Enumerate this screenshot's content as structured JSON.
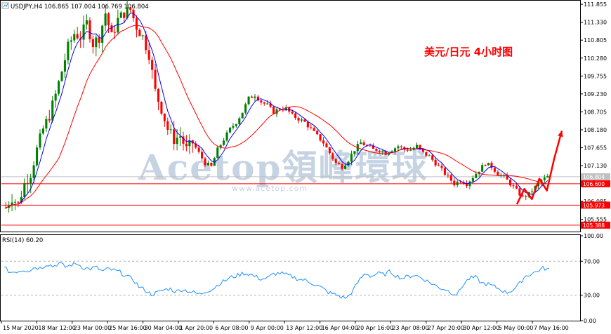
{
  "chart_data": [
    {
      "type": "candlestick",
      "title": "USDJPY,H4  106.865 107.004 106.769 106.804",
      "annotation": "美元/日元  4小时图",
      "watermark": "Acetop領峰環球",
      "watermark_url": "www.acetop.com",
      "x_ticks": [
        "15 Mar 2020",
        "18 Mar 12:00",
        "23 Mar 00:00",
        "25 Mar 16:00",
        "30 Mar 04:00",
        "1 Apr 20:00",
        "6 Apr 08:00",
        "9 Apr 00:00",
        "13 Apr 12:00",
        "16 Apr 04:00",
        "20 Apr 16:00",
        "23 Apr 08:00",
        "27 Apr 20:00",
        "30 Apr 12:00",
        "5 May 00:00",
        "7 May 16:00"
      ],
      "y_ticks": [
        111.855,
        111.33,
        110.805,
        110.28,
        109.755,
        109.23,
        108.705,
        108.18,
        107.655,
        107.13,
        106.6,
        106.085,
        105.555
      ],
      "ylim": [
        105.2,
        111.96
      ],
      "last_price": 106.804,
      "levels": [
        {
          "value": 106.6,
          "label": "106.600",
          "color": "#ff0000"
        },
        {
          "value": 105.973,
          "label": "105.973",
          "color": "#ff0000"
        },
        {
          "value": 105.388,
          "label": "105.388",
          "color": "#ff0000"
        }
      ],
      "series": [
        {
          "name": "MA-fast",
          "color": "#0000ff"
        },
        {
          "name": "MA-slow",
          "color": "#ff0000"
        }
      ],
      "up_color": "#008000",
      "down_color": "#ff0000",
      "close_path": [
        105.9,
        106.2,
        106.0,
        106.6,
        106.9,
        107.6,
        108.2,
        108.6,
        109.2,
        109.9,
        110.6,
        111.0,
        110.9,
        111.3,
        110.7,
        110.9,
        111.6,
        110.9,
        111.4,
        111.6,
        111.7,
        111.2,
        110.9,
        110.4,
        109.3,
        108.8,
        108.2,
        107.9,
        108.0,
        107.6,
        107.8,
        107.5,
        107.2,
        107.1,
        107.6,
        107.9,
        108.2,
        108.4,
        108.7,
        109.1,
        109.2,
        109.0,
        108.9,
        108.7,
        108.8,
        108.8,
        108.6,
        108.5,
        108.4,
        108.2,
        108.0,
        107.8,
        107.5,
        107.2,
        107.1,
        107.3,
        107.6,
        107.8,
        107.7,
        107.6,
        107.6,
        107.5,
        107.6,
        107.7,
        107.6,
        107.6,
        107.7,
        107.5,
        107.4,
        107.2,
        107.0,
        106.8,
        106.6,
        106.7,
        106.6,
        106.8,
        107.0,
        107.2,
        107.1,
        106.9,
        106.8,
        106.6,
        106.4,
        106.2,
        106.3,
        106.5,
        106.7,
        106.8
      ],
      "projection": [
        106.0,
        106.45,
        106.15,
        106.75,
        106.4,
        107.35,
        108.15
      ]
    },
    {
      "type": "line",
      "title": "RSI(14) 60.20",
      "ylim": [
        0,
        100
      ],
      "y_ticks": [
        100.0,
        70.0,
        30.0,
        0.0
      ],
      "y_tick_labels": [
        "100.00",
        "70.00",
        "30.00",
        "0.00"
      ],
      "dashed_levels": [
        70,
        30
      ],
      "color": "#1e90ff",
      "values": [
        62,
        57,
        58,
        60,
        59,
        63,
        62,
        67,
        64,
        68,
        63,
        66,
        67,
        62,
        61,
        63,
        58,
        61,
        59,
        57,
        52,
        49,
        40,
        36,
        31,
        33,
        36,
        38,
        34,
        37,
        35,
        33,
        31,
        35,
        37,
        43,
        47,
        51,
        53,
        56,
        55,
        52,
        49,
        50,
        55,
        56,
        54,
        52,
        49,
        48,
        45,
        42,
        38,
        33,
        31,
        28,
        27,
        36,
        48,
        56,
        52,
        56,
        54,
        58,
        53,
        50,
        52,
        54,
        51,
        47,
        43,
        39,
        37,
        33,
        31,
        43,
        50,
        51,
        44,
        43,
        40,
        37,
        33,
        36,
        42,
        52,
        55,
        58,
        62,
        60
      ]
    }
  ]
}
